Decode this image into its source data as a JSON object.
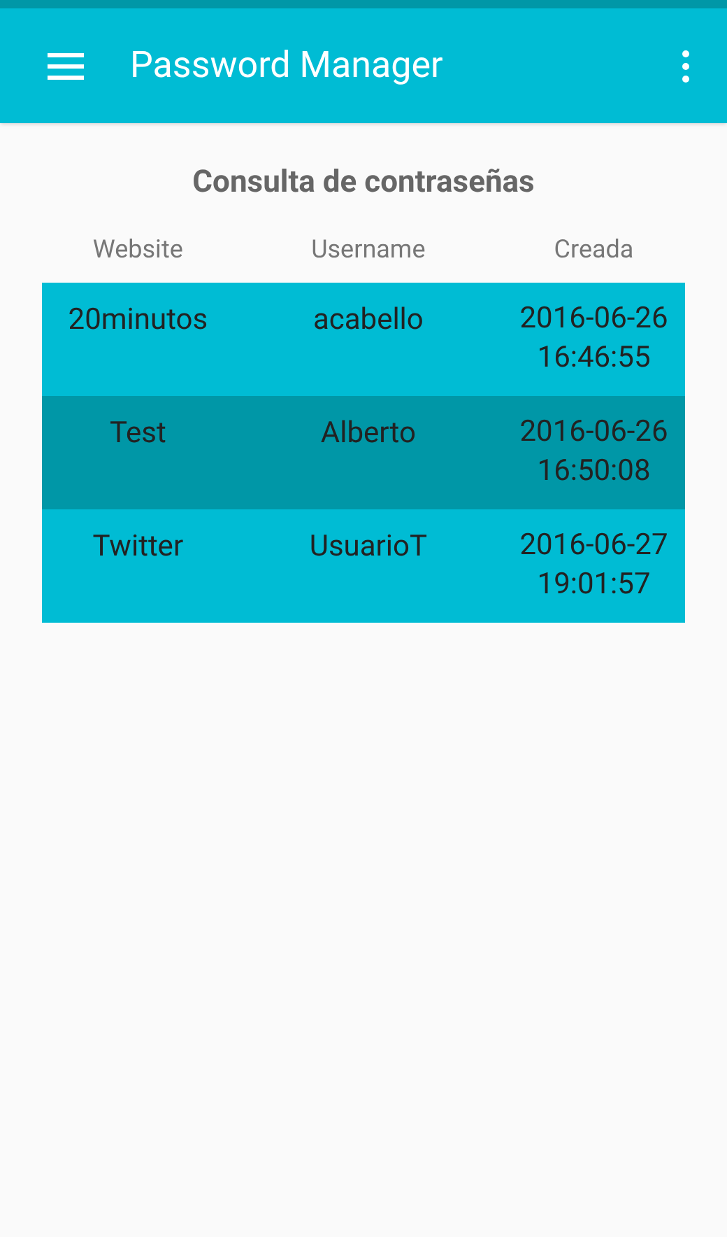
{
  "app_bar": {
    "title": "Password Manager"
  },
  "heading": "Consulta de contraseñas",
  "table": {
    "columns": [
      "Website",
      "Username",
      "Creada"
    ],
    "rows": [
      {
        "website": "20minutos",
        "username": "acabello",
        "created": [
          "2016-06-26",
          "16:46:55"
        ],
        "selected": false
      },
      {
        "website": "Test",
        "username": "Alberto",
        "created": [
          "2016-06-26",
          "16:50:08"
        ],
        "selected": true
      },
      {
        "website": "Twitter",
        "username": "UsuarioT",
        "created": [
          "2016-06-27",
          "19:01:57"
        ],
        "selected": false
      }
    ]
  }
}
